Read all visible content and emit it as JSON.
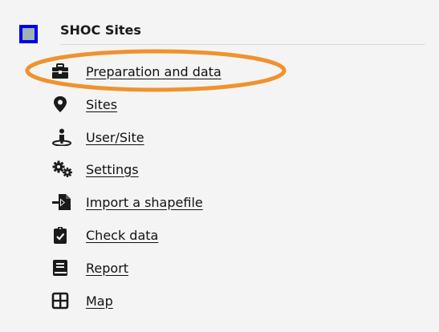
{
  "section": {
    "title": "SHOC Sites",
    "icon": "module-square-icon"
  },
  "menu": {
    "items": [
      {
        "label": "Preparation and data",
        "icon": "toolbox-icon"
      },
      {
        "label": "Sites",
        "icon": "map-marker-icon"
      },
      {
        "label": "User/Site",
        "icon": "person-pin-icon"
      },
      {
        "label": "Settings",
        "icon": "gears-icon"
      },
      {
        "label": "Import a shapefile",
        "icon": "file-import-icon"
      },
      {
        "label": "Check data",
        "icon": "clipboard-check-icon"
      },
      {
        "label": "Report",
        "icon": "book-icon"
      },
      {
        "label": "Map",
        "icon": "grid-map-icon"
      }
    ]
  },
  "colors": {
    "highlight_ring": "#f0922e",
    "module_border": "#0000ee",
    "module_fill": "#9fb3b0",
    "icon_color": "#1a1a1a"
  }
}
